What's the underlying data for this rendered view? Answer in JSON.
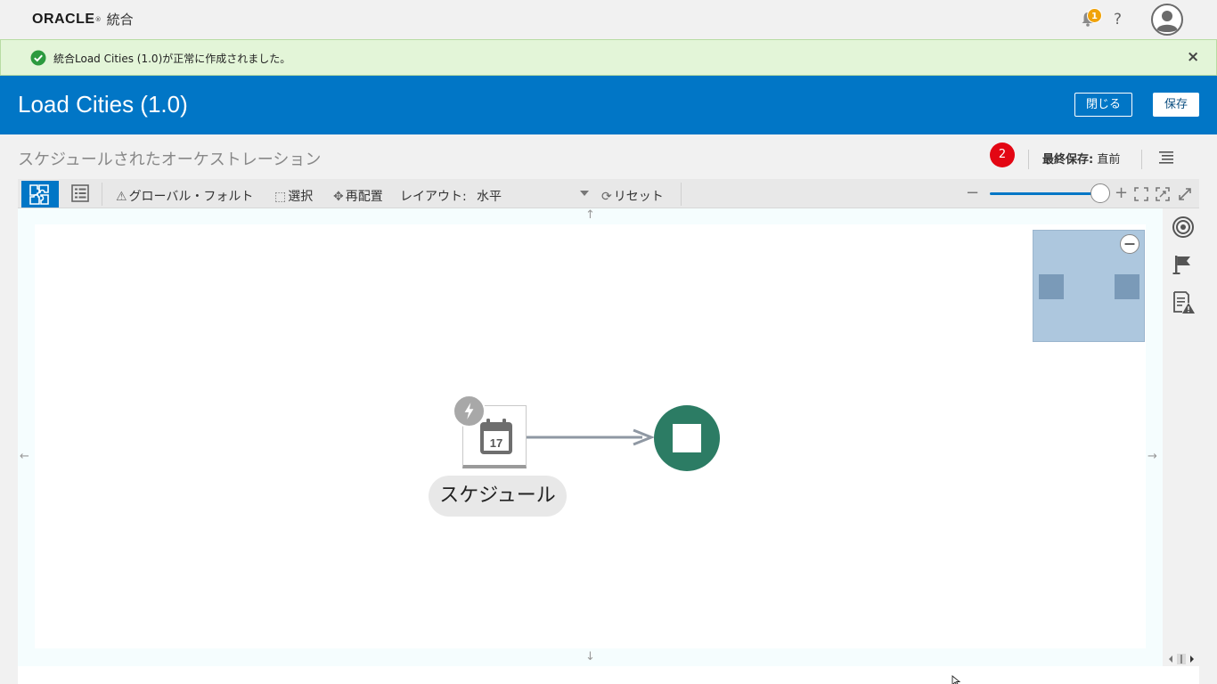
{
  "topbar": {
    "logo": "ORACLE",
    "logo_reg": "®",
    "app_name": "統合",
    "notification_count": "1",
    "help": "?"
  },
  "banner": {
    "message": "統合Load Cities (1.0)が正常に作成されました。",
    "close": "×"
  },
  "header": {
    "title": "Load Cities (1.0)",
    "close_label": "閉じる",
    "save_label": "保存"
  },
  "subheader": {
    "orchestration_type": "スケジュールされたオーケストレーション",
    "error_count": "2",
    "last_saved_label": "最終保存:",
    "last_saved_value": "直前"
  },
  "toolbar": {
    "global_fault": "グローバル・フォルト",
    "select": "選択",
    "rearrange": "再配置",
    "layout_label": "レイアウト:",
    "layout_value": "水平",
    "reset": "リセット",
    "zoom_level": 0.98
  },
  "canvas": {
    "schedule_date": "17",
    "schedule_label": "スケジュール",
    "pan_up": "↑",
    "pan_down": "↓",
    "pan_left": "←",
    "pan_right": "→"
  },
  "colors": {
    "accent": "#0176c6",
    "success_bg": "#e3f5d8",
    "error": "#e30613",
    "end_node": "#2c7c64",
    "badge": "#f0a30a"
  }
}
